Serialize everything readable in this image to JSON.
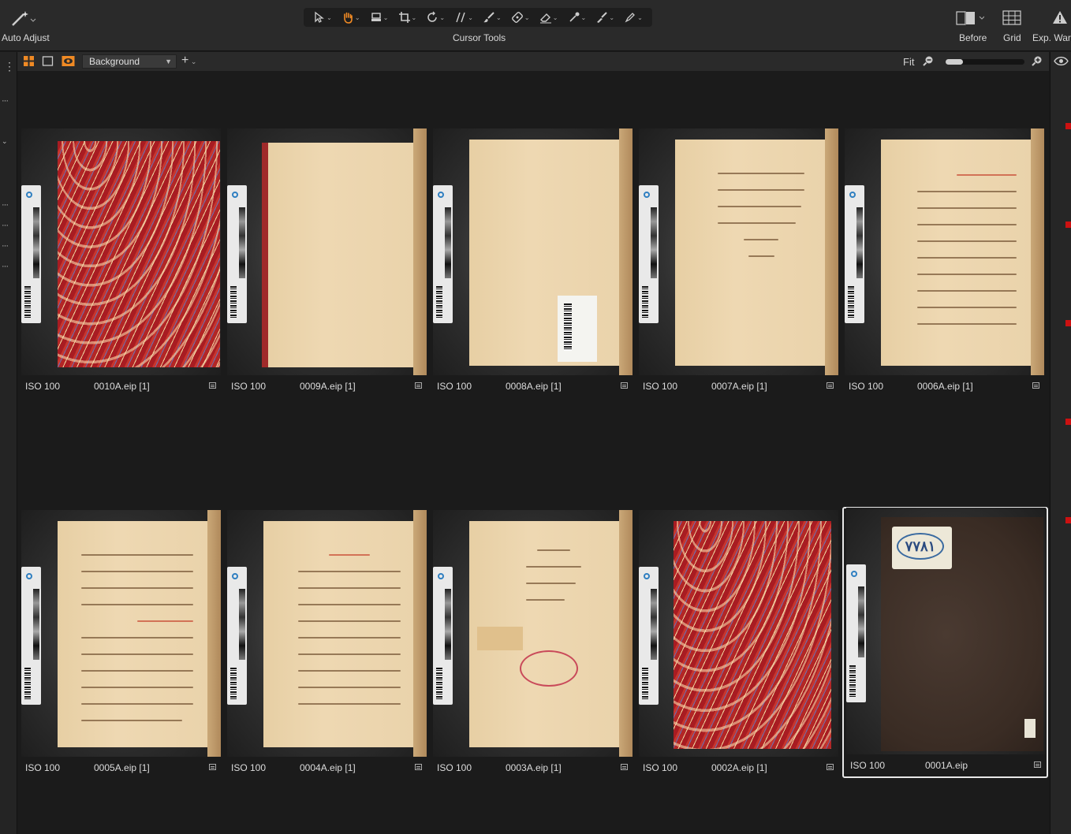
{
  "toolbar": {
    "auto_adjust_label": "Auto Adjust",
    "cursor_tools_label": "Cursor Tools",
    "before_label": "Before",
    "grid_label": "Grid",
    "exp_warn_label": "Exp. Warn"
  },
  "viewer_bar": {
    "layer_select_value": "Background",
    "fit_label": "Fit",
    "zoom_level": 0.22
  },
  "thumbnails": [
    {
      "iso": "ISO 100",
      "filename": "0010A.eip [1]"
    },
    {
      "iso": "ISO 100",
      "filename": "0009A.eip [1]"
    },
    {
      "iso": "ISO 100",
      "filename": "0008A.eip [1]"
    },
    {
      "iso": "ISO 100",
      "filename": "0007A.eip [1]"
    },
    {
      "iso": "ISO 100",
      "filename": "0006A.eip [1]"
    },
    {
      "iso": "ISO 100",
      "filename": "0005A.eip [1]"
    },
    {
      "iso": "ISO 100",
      "filename": "0004A.eip [1]"
    },
    {
      "iso": "ISO 100",
      "filename": "0003A.eip [1]"
    },
    {
      "iso": "ISO 100",
      "filename": "0002A.eip [1]"
    },
    {
      "iso": "ISO 100",
      "filename": "0001A.eip"
    }
  ],
  "selected_thumbnail": "0001A.eip",
  "book_label_0001": "٧٧٨١",
  "colors": {
    "accent_orange": "#f08a24",
    "flag_red": "#cc1111",
    "selection_border": "#e8e8e8"
  },
  "icons": [
    "magic-wand-icon",
    "pointer-icon",
    "hand-icon",
    "stamp-icon",
    "crop-icon",
    "rotate-icon",
    "straighten-icon",
    "brush-icon",
    "eraser-icon",
    "mask-icon",
    "picker-icon",
    "pen-icon",
    "before-icon",
    "grid-icon",
    "warning-icon",
    "grid-view-icon",
    "single-view-icon",
    "eye-icon",
    "plus-icon",
    "zoom-out-icon",
    "zoom-in-icon"
  ]
}
